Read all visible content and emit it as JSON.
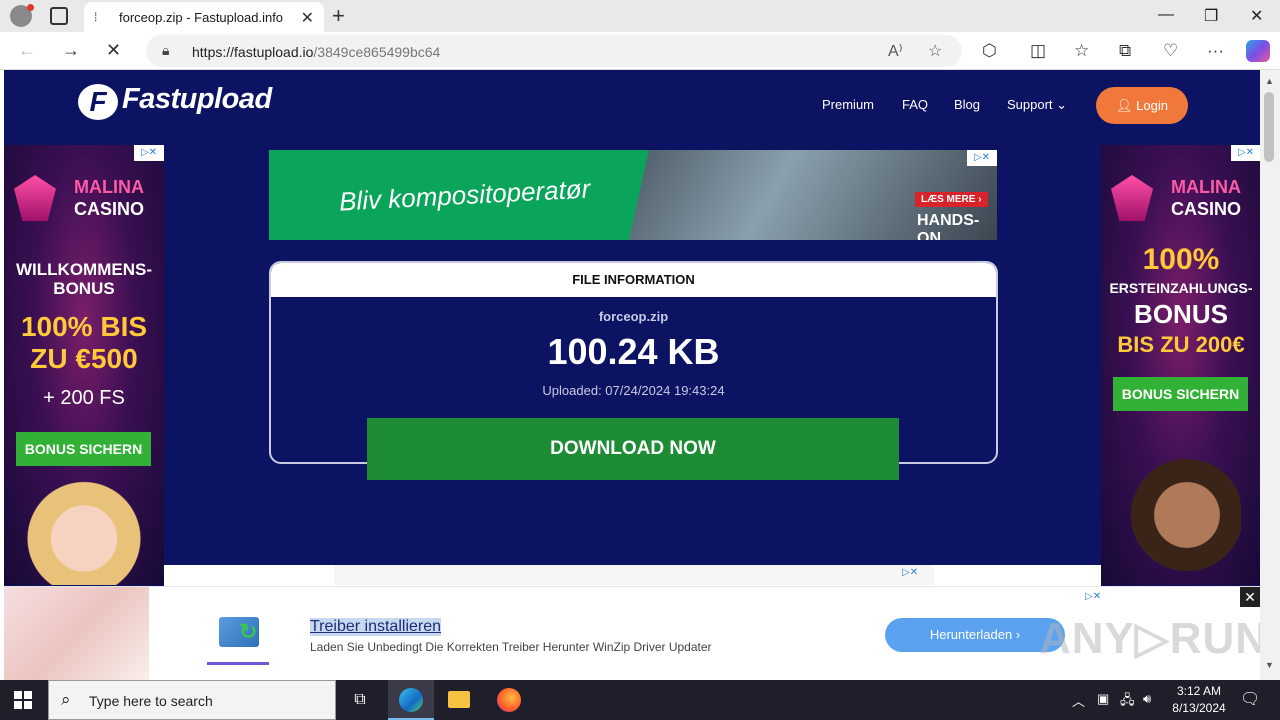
{
  "browser": {
    "tab_title": "forceop.zip - Fastupload.info",
    "url_host": "https://fastupload.io",
    "url_path": "/3849ce865499bc64"
  },
  "site": {
    "logo_text": "Fastupload",
    "logo_mark": "F",
    "menu": [
      "Premium",
      "FAQ",
      "Blog",
      "Support ⌄"
    ],
    "login_label": "Login"
  },
  "left_ad": {
    "brand_line1": "MALINA",
    "brand_line2": "CASINO",
    "line1": "WILLKOMMENS-",
    "line2": "BONUS",
    "line3": "100% BIS",
    "line4": "ZU €500",
    "line5": "+ 200 FS",
    "button": "BONUS SICHERN"
  },
  "right_ad": {
    "brand_line1": "MALINA",
    "brand_line2": "CASINO",
    "line1": "100%",
    "line2": "ERSTEINZAHLUNGS-",
    "line3": "BONUS",
    "line4": "BIS ZU 200€",
    "button": "BONUS SICHERN"
  },
  "top_banner": {
    "headline": "Bliv kompositoperatør",
    "tag1": "LÆS MERE ›",
    "tag2": "HANDS-ON"
  },
  "file_info": {
    "header": "FILE INFORMATION",
    "filename": "forceop.zip",
    "size": "100.24 KB",
    "uploaded": "Uploaded: 07/24/2024 19:43:24",
    "download_label": "DOWNLOAD NOW"
  },
  "sticky_ad": {
    "title": "Treiber installieren",
    "description": "Laden Sie Unbedingt Die Korrekten Treiber Herunter WinZip Driver Updater",
    "cta": "Herunterladen  ›",
    "watermark": "ANY▷RUN"
  },
  "taskbar": {
    "search_placeholder": "Type here to search",
    "time": "3:12 AM",
    "date": "8/13/2024"
  },
  "colors": {
    "page_bg": "#0c1362",
    "login_btn": "#f0783a",
    "download_btn": "#1e8c35"
  }
}
